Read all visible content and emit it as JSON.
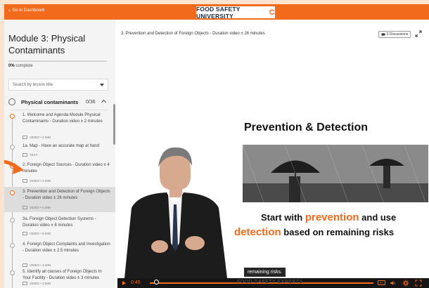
{
  "header": {
    "back_label": "Go to Dashboard",
    "brand": "FOOD SAFETY UNIVERSITY"
  },
  "sidebar": {
    "module_title": "Module 3: Physical Contaminants",
    "progress_percent": 0,
    "progress_value": "0%",
    "progress_text": "complete",
    "search_placeholder": "Search by lesson title",
    "section": {
      "title": "Physical contaminants",
      "count": "0/36"
    },
    "lessons": [
      {
        "title": "1. Welcome and Agenda Module Physical Contaminants - Duration video ± 2 minutes",
        "meta": "VIDEO • 2 MIN"
      },
      {
        "title": "1a. Map - Have an accurate map at hand",
        "meta": "TEXT"
      },
      {
        "title": "2. Foreign Object Sources - Duration video ± 4 minutes",
        "meta": "VIDEO • 4 MIN"
      },
      {
        "title": "3. Prevention and Detection of Foreign Objects - Duration video ± 26 minutes",
        "meta": "VIDEO • 5 MIN"
      },
      {
        "title": "3a. Foreign Object Detection Systems - Duration video ± 8 minutes",
        "meta": "VIDEO • 8 MIN"
      },
      {
        "title": "4. Foreign Object Complaints and Investigation - Duration video ± 2.5 minutes",
        "meta": "VIDEO • 3 MIN"
      },
      {
        "title": "5. Identify all classes of Foreign Objects In Your Facility - Duration video ± 3 minutes",
        "meta": "VIDEO • 3 MIN"
      }
    ]
  },
  "main": {
    "video_title": "3. Prevention and Detection of Foreign Objects - Duration video ± 26 minutes",
    "discussions_label": "0 Discussions",
    "slide": {
      "heading": "Prevention & Detection",
      "line1_pre": "Start with ",
      "line1_hl": "prevention",
      "line1_post": " and use",
      "line2_hl": "detection",
      "line2_post": " based on remaining risks"
    },
    "caption": "remaining risks.",
    "player": {
      "time": "0:45",
      "watermark": "FOOD SAFETY EXPERTS",
      "cc_label": "CC",
      "progress_fraction": 0.03
    }
  },
  "colors": {
    "accent": "#f26b1d",
    "navy": "#1a2a44",
    "page_bg": "#fbe3cf"
  },
  "icons": [
    "chevron-left-icon",
    "refresh-logo-icon",
    "chevron-down-icon",
    "chevron-up-icon",
    "video-icon",
    "text-icon",
    "chat-icon",
    "expand-icon",
    "play-icon",
    "cc-icon",
    "volume-icon",
    "settings-icon",
    "fullscreen-icon",
    "arrow-icon"
  ]
}
